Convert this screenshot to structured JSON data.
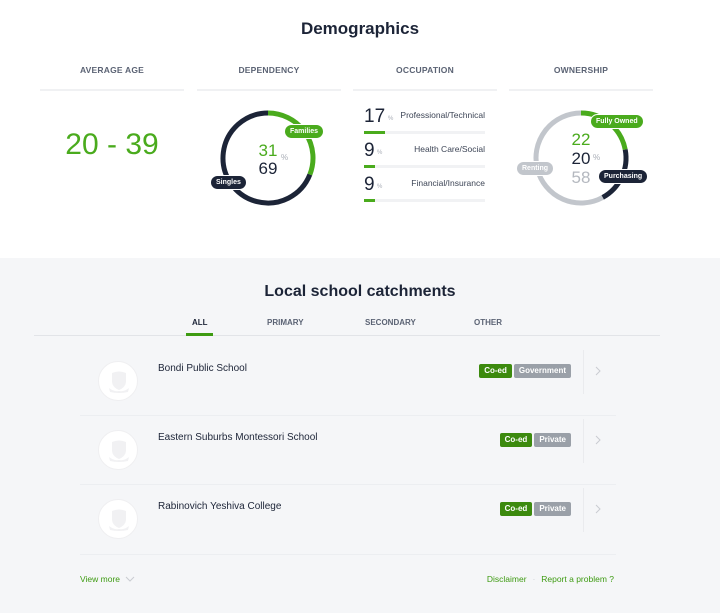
{
  "demographics": {
    "title": "Demographics",
    "average_age": {
      "heading": "AVERAGE AGE",
      "value": "20 - 39"
    },
    "dependency": {
      "heading": "DEPENDENCY",
      "families": {
        "label": "Families",
        "value": "31",
        "percent": 31
      },
      "singles": {
        "label": "Singles",
        "value": "69",
        "percent": 69
      },
      "unit": "%"
    },
    "occupation": {
      "heading": "OCCUPATION",
      "unit": "%",
      "items": [
        {
          "value": "17",
          "label": "Professional/Technical",
          "percent": 17
        },
        {
          "value": "9",
          "label": "Health Care/Social",
          "percent": 9
        },
        {
          "value": "9",
          "label": "Financial/Insurance",
          "percent": 9
        }
      ]
    },
    "ownership": {
      "heading": "OWNERSHIP",
      "unit": "%",
      "fully_owned": {
        "label": "Fully Owned",
        "value": "22",
        "percent": 22
      },
      "purchasing": {
        "label": "Purchasing",
        "value": "20",
        "percent": 20
      },
      "renting": {
        "label": "Renting",
        "value": "58",
        "percent": 58
      }
    }
  },
  "schools": {
    "title": "Local school catchments",
    "tabs": [
      {
        "label": "ALL",
        "active": true
      },
      {
        "label": "PRIMARY",
        "active": false
      },
      {
        "label": "SECONDARY",
        "active": false
      },
      {
        "label": "OTHER",
        "active": false
      }
    ],
    "list": [
      {
        "name": "Bondi Public School",
        "tags": [
          "Co-ed",
          "Government"
        ]
      },
      {
        "name": "Eastern Suburbs Montessori School",
        "tags": [
          "Co-ed",
          "Private"
        ]
      },
      {
        "name": "Rabinovich Yeshiva College",
        "tags": [
          "Co-ed",
          "Private"
        ]
      }
    ],
    "view_more": "View more",
    "disclaimer": "Disclaimer",
    "separator": "·",
    "report": "Report a problem ?"
  },
  "colors": {
    "green": "#4aab1d",
    "navy": "#1c2437",
    "grey": "#c2c6cc",
    "tag_green": "#3c8a0e",
    "tag_grey": "#9aa0a8"
  }
}
